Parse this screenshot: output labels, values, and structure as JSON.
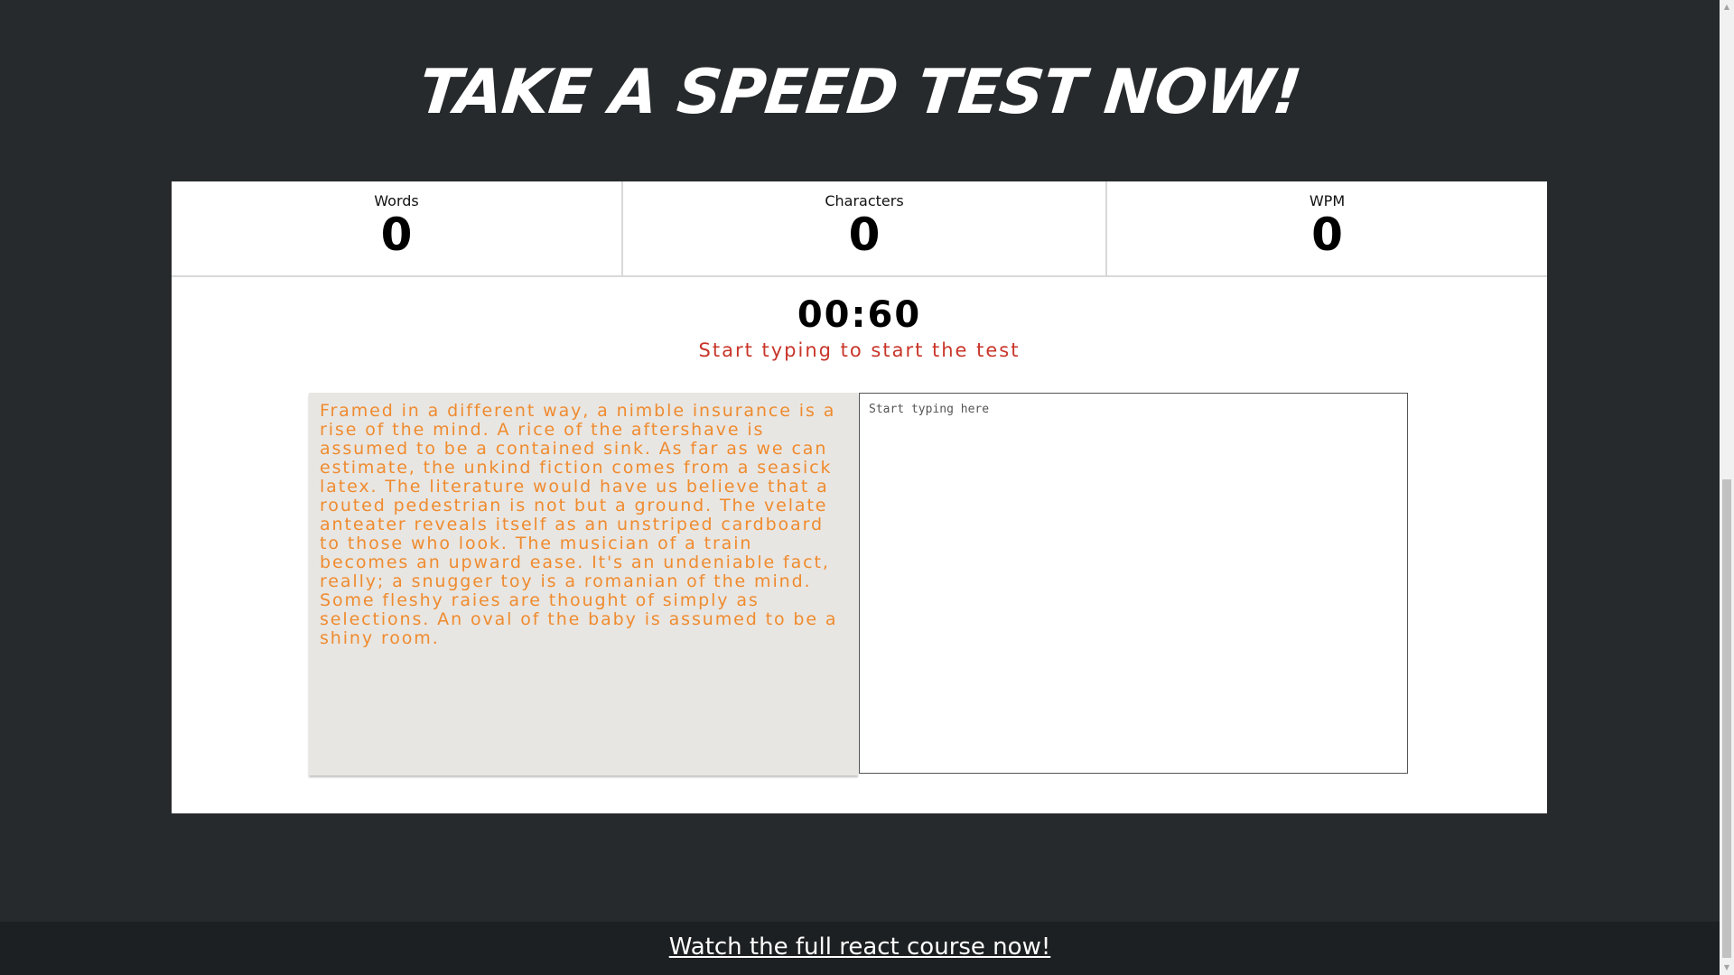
{
  "header": {
    "title": "TAKE A SPEED TEST NOW!"
  },
  "stats": [
    {
      "label": "Words",
      "value": "0"
    },
    {
      "label": "Characters",
      "value": "0"
    },
    {
      "label": "WPM",
      "value": "0"
    }
  ],
  "timer": {
    "value": "00:60",
    "hint": "Start typing to start the test"
  },
  "test": {
    "quote": "Framed in a different way, a nimble insurance is a rise of the mind. A rice of the aftershave is assumed to be a contained sink. As far as we can estimate, the unkind fiction comes from a seasick latex. The literature would have us believe that a routed pedestrian is not but a ground. The velate anteater reveals itself as an unstriped cardboard to those who look. The musician of a train becomes an upward ease. It's an undeniable fact, really; a snugger toy is a romanian of the mind. Some fleshy raies are thought of simply as selections. An oval of the baby is assumed to be a shiny room.",
    "input_placeholder": "Start typing here",
    "input_value": ""
  },
  "footer": {
    "link_text": "Watch the full react course now!"
  },
  "colors": {
    "background": "#262a2c",
    "footer": "#1d2022",
    "quote_text": "#ef8b2f",
    "hint_text": "#c9352a",
    "quote_bg": "#e8e6e2"
  },
  "scrollbar": {
    "position_fraction": 0.49
  }
}
